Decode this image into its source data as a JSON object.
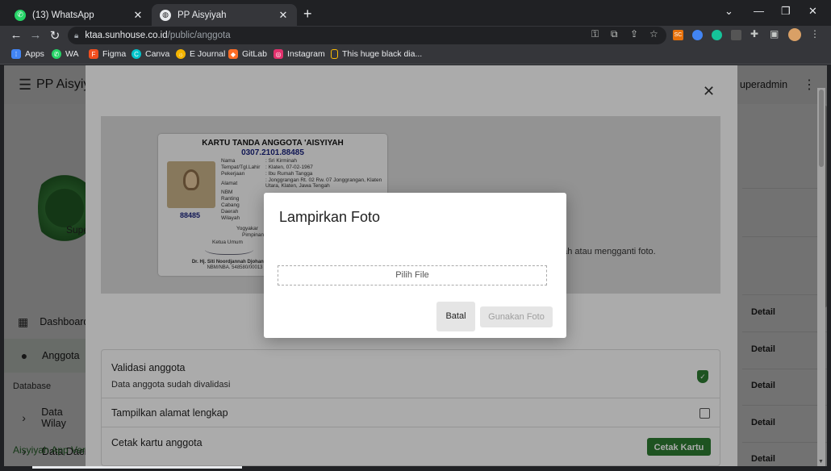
{
  "browser": {
    "tabs": [
      {
        "label": "(13) WhatsApp",
        "icon": "whatsapp-icon",
        "color": "#25d366"
      },
      {
        "label": "PP Aisyiyah",
        "icon": "globe-icon",
        "color": "#e8eaed"
      }
    ],
    "url_domain": "ktaa.sunhouse.co.id",
    "url_path": "/public/anggota",
    "bookmarks": [
      {
        "label": "Apps",
        "icon": "apps-grid-icon",
        "color": "#4285f4"
      },
      {
        "label": "WA",
        "icon": "whatsapp-icon",
        "color": "#25d366"
      },
      {
        "label": "Figma",
        "icon": "figma-icon",
        "color": "#f24e1e"
      },
      {
        "label": "Canva",
        "icon": "canva-icon",
        "color": "#00c4cc"
      },
      {
        "label": "E Journal",
        "icon": "ejournal-icon",
        "color": "#f4b400"
      },
      {
        "label": "GitLab",
        "icon": "gitlab-icon",
        "color": "#fc6d26"
      },
      {
        "label": "Instagram",
        "icon": "instagram-icon",
        "color": "#e1306c"
      },
      {
        "label": "This huge black dia...",
        "icon": "bookmark-page-icon",
        "color": "#fbbc04"
      }
    ],
    "ext_badge": "SC"
  },
  "app": {
    "title": "PP Aisyiy",
    "user": "uperadmin",
    "sidebar_role": "Supe",
    "sidebar": {
      "dashboard": "Dashboard",
      "anggota": "Anggota",
      "section_database": "Database",
      "data_wilayah": "Data Wilay",
      "data_daerah": "Data Daer",
      "footer": "Aisyiyah App Ver"
    },
    "detail_label": "Detail"
  },
  "member_dialog": {
    "card": {
      "heading": "KARTU TANDA ANGGOTA 'AISYIYAH",
      "number": "0307.2101.88485",
      "short_number": "88485",
      "fields": [
        {
          "label": "Nama",
          "value": ": Sri Kirminah"
        },
        {
          "label": "Tempat/Tgl.Lahir",
          "value": ": Klaten, 07-02-1967"
        },
        {
          "label": "Pekerjaan",
          "value": ": Ibu Rumah Tangga"
        },
        {
          "label": "Alamat",
          "value": ": Jonggrangan Rt. 02 Rw. 07 Jonggrangan, Klaten Utara, Klaten, Jawa Tengah"
        },
        {
          "label": "NBM",
          "value": ": 88485"
        },
        {
          "label": "Ranting",
          "value": ""
        },
        {
          "label": "Cabang",
          "value": ""
        },
        {
          "label": "Daerah",
          "value": ""
        },
        {
          "label": "Wilayah",
          "value": ""
        }
      ],
      "city": "Yogyakar",
      "office": "Pimpinan",
      "chair_title": "Ketua Umum",
      "chair_name": "Dr. Hj. Siti Noordjannah Djohantini, M",
      "chair_nbm": "NBM/NBA. 548580/00013"
    },
    "photo_hint": "bah atau mengganti foto.",
    "validation_title": "Validasi anggota",
    "validation_sub": "Data anggota sudah divalidasi",
    "show_address": "Tampilkan alamat lengkap",
    "print_title": "Cetak kartu anggota",
    "print_button": "Cetak Kartu"
  },
  "attach_dialog": {
    "title": "Lampirkan Foto",
    "choose_file": "Pilih File",
    "cancel": "Batal",
    "use_photo": "Gunakan Foto"
  }
}
